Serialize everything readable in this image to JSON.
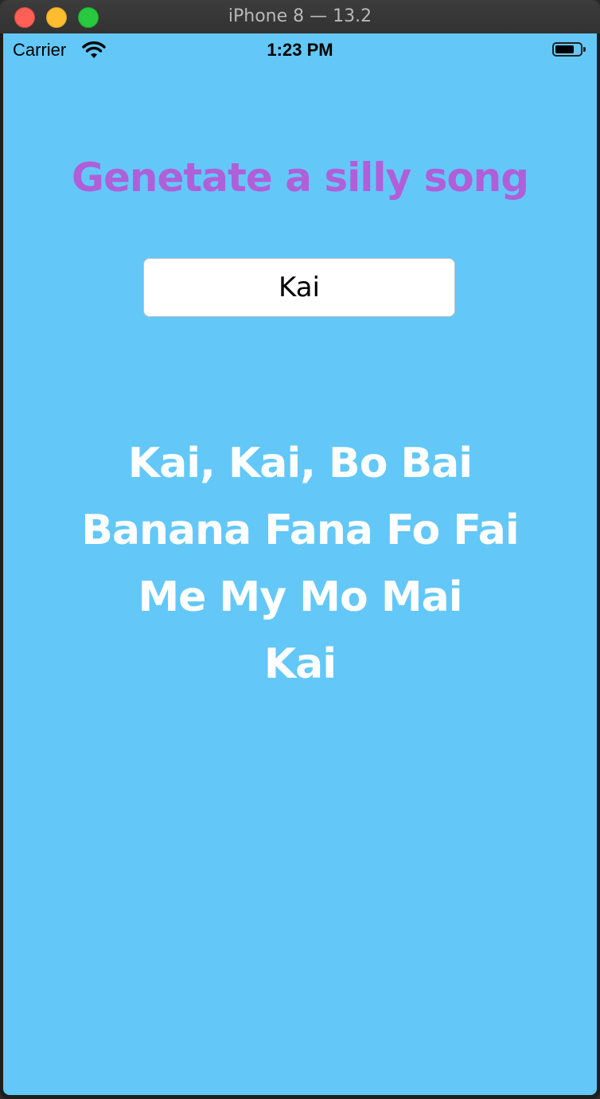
{
  "window": {
    "title": "iPhone 8 — 13.2"
  },
  "status_bar": {
    "carrier": "Carrier",
    "time": "1:23 PM",
    "wifi_icon": "wifi-icon",
    "battery_icon": "battery-icon",
    "battery_level": 0.75
  },
  "app": {
    "heading": "Genetate a silly song",
    "name_input": {
      "value": "Kai",
      "placeholder": ""
    },
    "song_lines": [
      "Kai, Kai, Bo Bai",
      "Banana Fana Fo Fai",
      "Me My Mo Mai",
      "Kai"
    ]
  },
  "colors": {
    "background": "#63c8f8",
    "heading": "#b05fd8",
    "song_text": "#ffffff"
  }
}
